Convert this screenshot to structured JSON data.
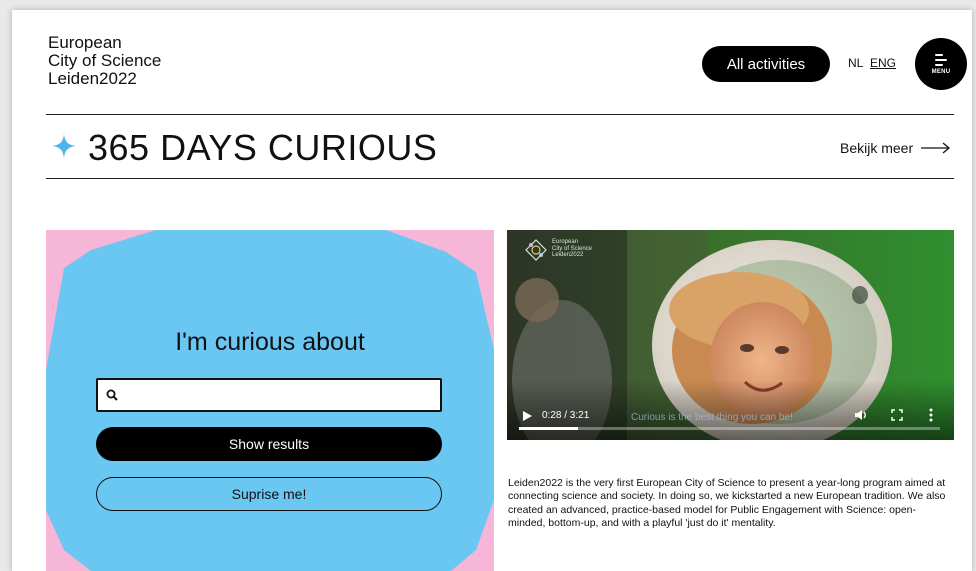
{
  "header": {
    "logo_lines": [
      "European",
      "City of Science",
      "Leiden2022"
    ],
    "activities_button": "All activities",
    "lang_nl": "NL",
    "lang_eng": "ENG",
    "menu_label": "MENU"
  },
  "banner": {
    "title": "365 DAYS CURIOUS",
    "see_more": "Bekijk meer"
  },
  "search": {
    "heading": "I'm curious about",
    "input_value": "",
    "show_results": "Show results",
    "surprise": "Suprise me!"
  },
  "video": {
    "logo_lines": [
      "European",
      "City of Science",
      "Leiden2022"
    ],
    "time": "0:28 / 3:21",
    "caption": "Curious is the best thing you can be!",
    "progress": 0.139
  },
  "description": "Leiden2022 is the very first European City of Science to present a year-long program aimed at connecting science and society. In doing so, we kickstarted a new European tradition. We also created an advanced, practice-based model for Public Engagement with Science: open-minded, bottom-up, and with a playful 'just do it' mentality.",
  "colors": {
    "panel_blue": "#69c7f2",
    "panel_pink": "#f5b6d8",
    "star_blue": "#4fb3e8",
    "black": "#000000"
  }
}
